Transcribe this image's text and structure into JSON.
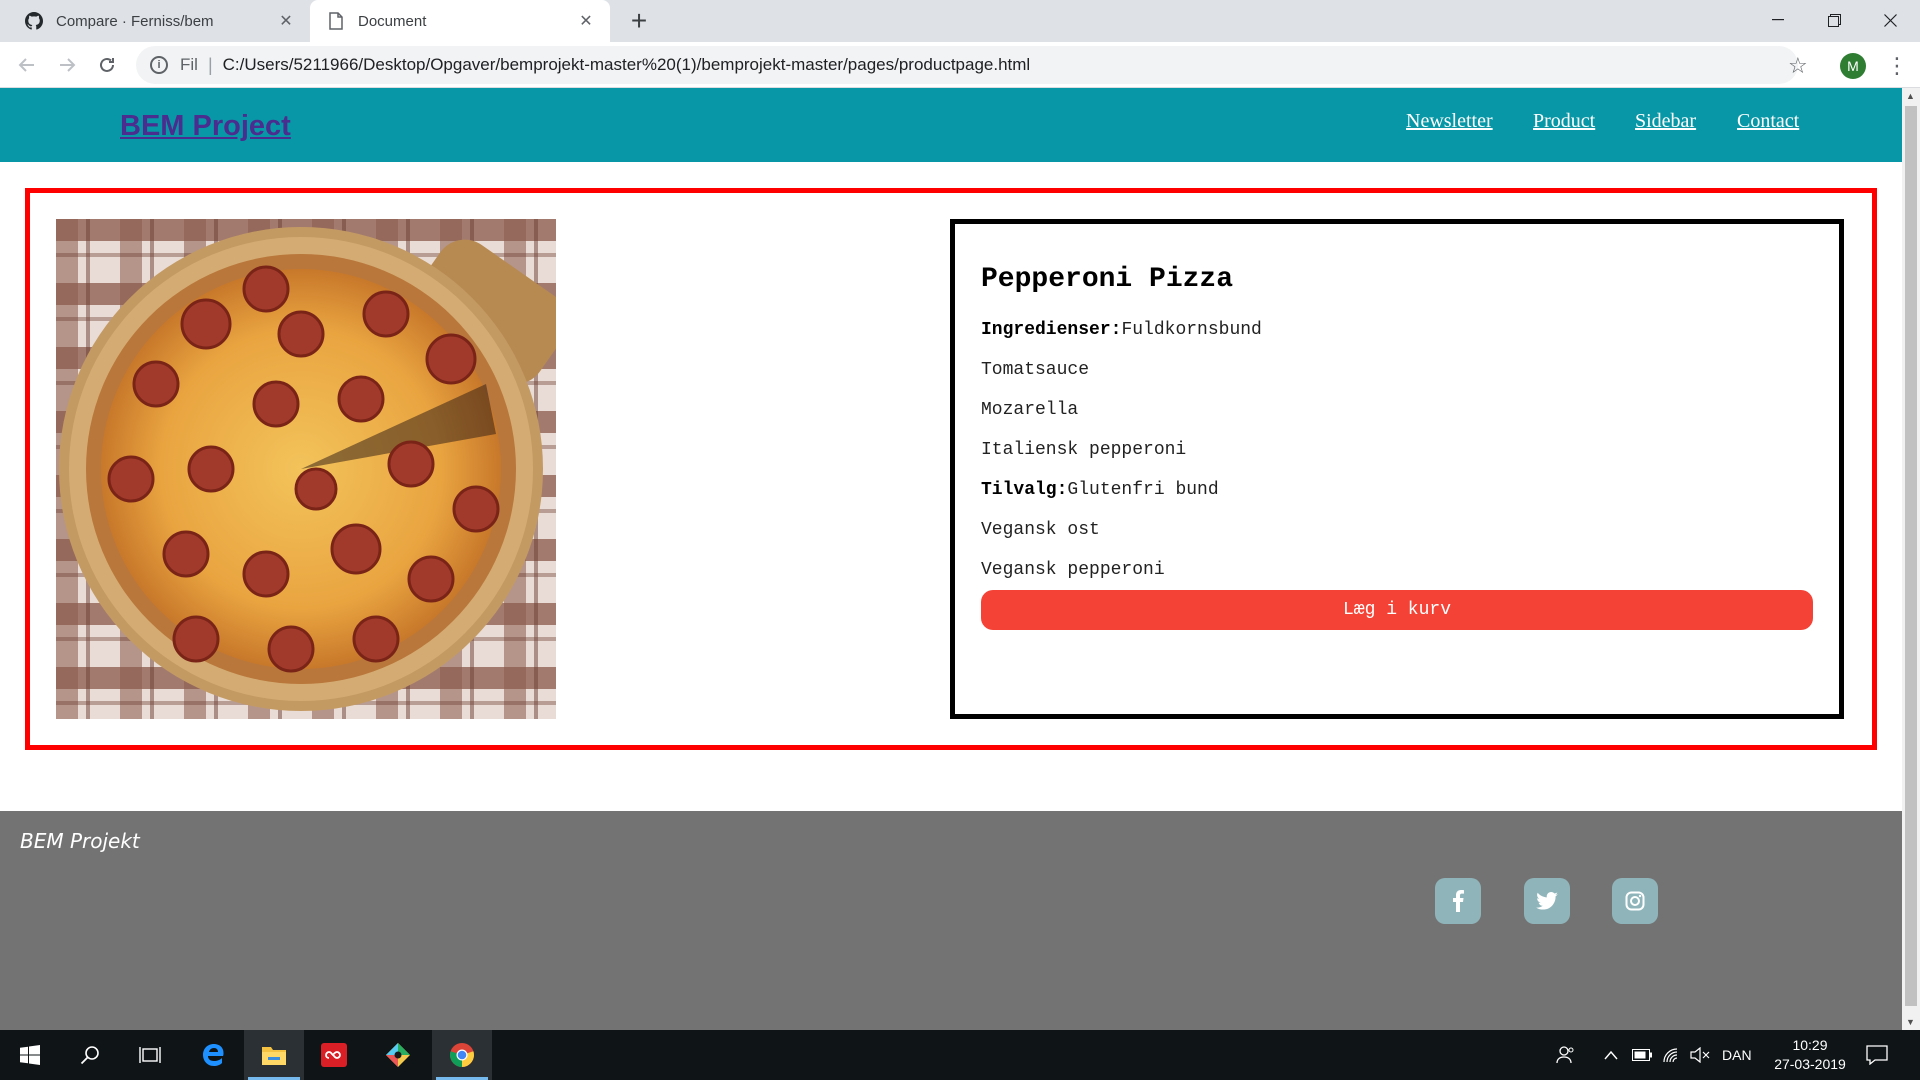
{
  "browser": {
    "tabs": [
      {
        "title": "Compare · Ferniss/bem",
        "icon": "github-icon"
      },
      {
        "title": "Document",
        "icon": "document-icon"
      }
    ],
    "address": {
      "scheme": "Fil",
      "url": "C:/Users/5211966/Desktop/Opgaver/bemprojekt-master%20(1)/bemprojekt-master/pages/productpage.html"
    },
    "profile_initial": "M"
  },
  "header": {
    "logo": "BEM Project",
    "nav": [
      "Newsletter",
      "Product",
      "Sidebar",
      "Contact"
    ],
    "bg_color": "#0897a6"
  },
  "product": {
    "name": "Pepperoni Pizza",
    "ingredients_label": "Ingredienser:",
    "ingredients": [
      "Fuldkornsbund",
      "Tomatsauce",
      "Mozarella",
      "Italiensk pepperoni"
    ],
    "options_label": "Tilvalg:",
    "options": [
      "Glutenfri bund",
      "Vegansk ost",
      "Vegansk pepperoni"
    ],
    "cart_button": "Læg i kurv",
    "cart_button_color": "#f44336",
    "card_border_color": "#ff0000"
  },
  "footer": {
    "title": "BEM Projekt",
    "social": [
      "facebook-icon",
      "twitter-icon",
      "instagram-icon"
    ]
  },
  "taskbar": {
    "language": "DAN",
    "time": "10:29",
    "date": "27-03-2019"
  }
}
